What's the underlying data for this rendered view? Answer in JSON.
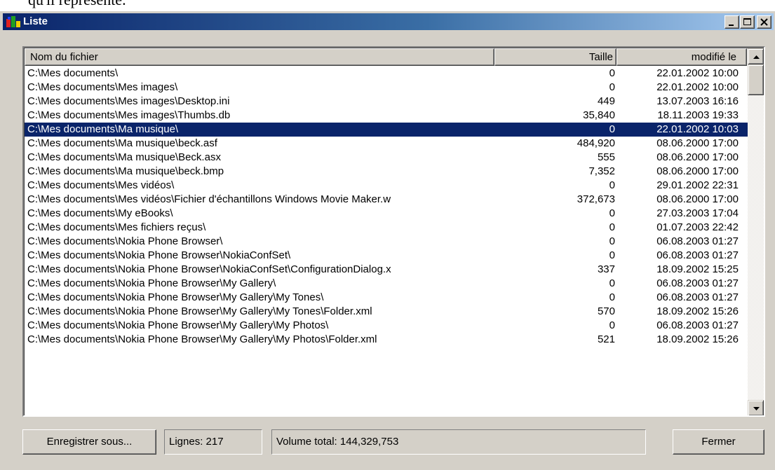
{
  "background_text": "qu'il représente.",
  "window": {
    "title": "Liste",
    "controls": {
      "minimize": "minimize",
      "maximize": "maximize",
      "close": "close"
    }
  },
  "list": {
    "columns": [
      "Nom du fichier",
      "Taille",
      "modifié le"
    ],
    "selected_index": 4,
    "rows": [
      {
        "name": "C:\\Mes documents\\",
        "size": "0",
        "modified": "22.01.2002 10:00"
      },
      {
        "name": "C:\\Mes documents\\Mes images\\",
        "size": "0",
        "modified": "22.01.2002 10:00"
      },
      {
        "name": "C:\\Mes documents\\Mes images\\Desktop.ini",
        "size": "449",
        "modified": "13.07.2003 16:16"
      },
      {
        "name": "C:\\Mes documents\\Mes images\\Thumbs.db",
        "size": "35,840",
        "modified": "18.11.2003 19:33"
      },
      {
        "name": "C:\\Mes documents\\Ma musique\\",
        "size": "0",
        "modified": "22.01.2002 10:03"
      },
      {
        "name": "C:\\Mes documents\\Ma musique\\beck.asf",
        "size": "484,920",
        "modified": "08.06.2000 17:00"
      },
      {
        "name": "C:\\Mes documents\\Ma musique\\Beck.asx",
        "size": "555",
        "modified": "08.06.2000 17:00"
      },
      {
        "name": "C:\\Mes documents\\Ma musique\\beck.bmp",
        "size": "7,352",
        "modified": "08.06.2000 17:00"
      },
      {
        "name": "C:\\Mes documents\\Mes vidéos\\",
        "size": "0",
        "modified": "29.01.2002 22:31"
      },
      {
        "name": "C:\\Mes documents\\Mes vidéos\\Fichier d'échantillons Windows Movie Maker.w",
        "size": "372,673",
        "modified": "08.06.2000 17:00"
      },
      {
        "name": "C:\\Mes documents\\My eBooks\\",
        "size": "0",
        "modified": "27.03.2003 17:04"
      },
      {
        "name": "C:\\Mes documents\\Mes fichiers reçus\\",
        "size": "0",
        "modified": "01.07.2003 22:42"
      },
      {
        "name": "C:\\Mes documents\\Nokia Phone Browser\\",
        "size": "0",
        "modified": "06.08.2003 01:27"
      },
      {
        "name": "C:\\Mes documents\\Nokia Phone Browser\\NokiaConfSet\\",
        "size": "0",
        "modified": "06.08.2003 01:27"
      },
      {
        "name": "C:\\Mes documents\\Nokia Phone Browser\\NokiaConfSet\\ConfigurationDialog.x",
        "size": "337",
        "modified": "18.09.2002 15:25"
      },
      {
        "name": "C:\\Mes documents\\Nokia Phone Browser\\My Gallery\\",
        "size": "0",
        "modified": "06.08.2003 01:27"
      },
      {
        "name": "C:\\Mes documents\\Nokia Phone Browser\\My Gallery\\My Tones\\",
        "size": "0",
        "modified": "06.08.2003 01:27"
      },
      {
        "name": "C:\\Mes documents\\Nokia Phone Browser\\My Gallery\\My Tones\\Folder.xml",
        "size": "570",
        "modified": "18.09.2002 15:26"
      },
      {
        "name": "C:\\Mes documents\\Nokia Phone Browser\\My Gallery\\My Photos\\",
        "size": "0",
        "modified": "06.08.2003 01:27"
      },
      {
        "name": "C:\\Mes documents\\Nokia Phone Browser\\My Gallery\\My Photos\\Folder.xml",
        "size": "521",
        "modified": "18.09.2002 15:26"
      }
    ]
  },
  "footer": {
    "save_as": "Enregistrer sous...",
    "lines": "Lignes: 217",
    "total": "Volume total: 144,329,753",
    "close": "Fermer"
  },
  "colors": {
    "face": "#d4d0c8",
    "selection": "#0a246a",
    "title_gradient_start": "#0a246a",
    "title_gradient_end": "#a6caf0"
  },
  "icons": {
    "app": "app-icon",
    "scroll_up": "arrow-up-icon",
    "scroll_down": "arrow-down-icon"
  }
}
